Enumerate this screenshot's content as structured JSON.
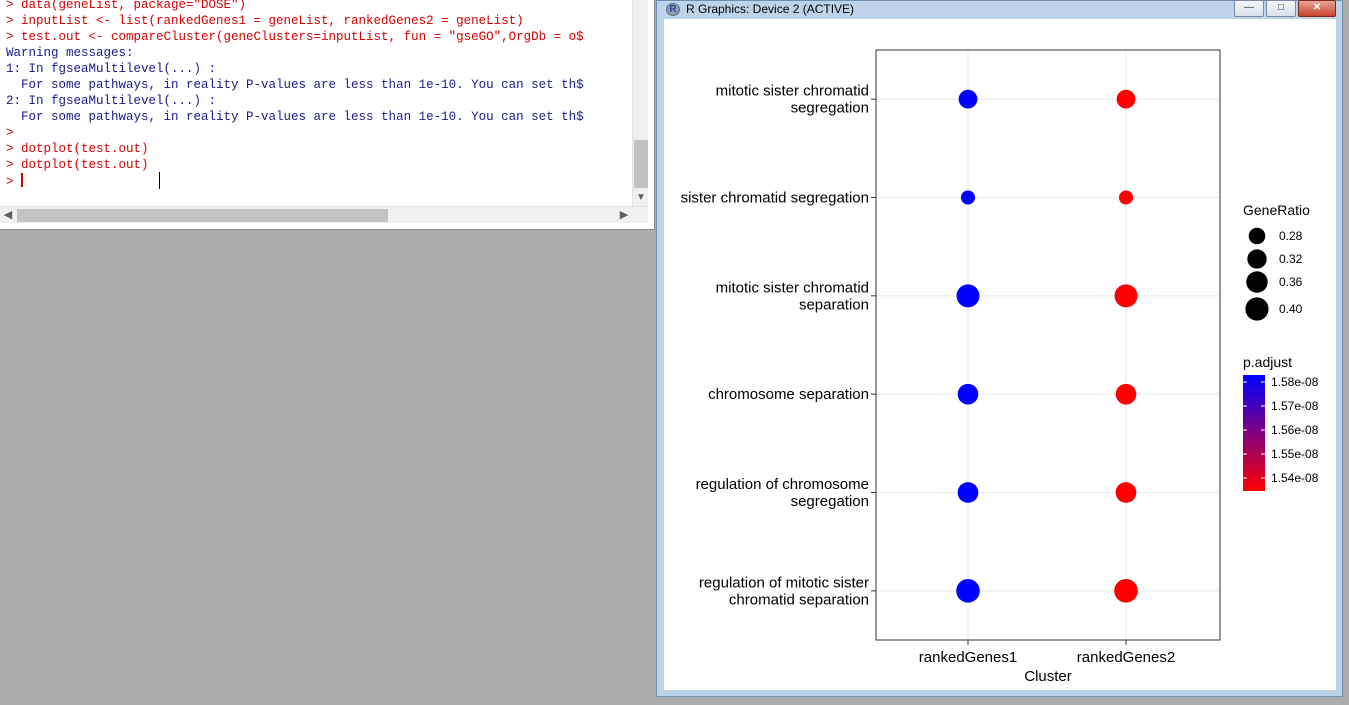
{
  "console": {
    "lines": [
      {
        "type": "cmd",
        "text": "> data(geneList, package=\"DOSE\")"
      },
      {
        "type": "cmd",
        "text": "> inputList <- list(rankedGenes1 = geneList, rankedGenes2 = geneList)"
      },
      {
        "type": "cmd",
        "text": "> test.out <- compareCluster(geneClusters=inputList, fun = \"gseGO\",OrgDb = o$"
      },
      {
        "type": "out",
        "text": "Warning messages:"
      },
      {
        "type": "out",
        "text": "1: In fgseaMultilevel(...) :"
      },
      {
        "type": "out",
        "text": "  For some pathways, in reality P-values are less than 1e-10. You can set th$"
      },
      {
        "type": "out",
        "text": "2: In fgseaMultilevel(...) :"
      },
      {
        "type": "out",
        "text": "  For some pathways, in reality P-values are less than 1e-10. You can set th$"
      },
      {
        "type": "cmd",
        "text": ">"
      },
      {
        "type": "cmd",
        "text": "> dotplot(test.out)"
      },
      {
        "type": "cmd",
        "text": "> dotplot(test.out)"
      }
    ],
    "prompt": "> "
  },
  "graphics_window": {
    "title": "R Graphics: Device 2 (ACTIVE)",
    "icon": "r-logo-icon"
  },
  "chart_data": {
    "type": "scatter",
    "xlabel": "Cluster",
    "ylabel": "",
    "categories": [
      "rankedGenes1",
      "rankedGenes2"
    ],
    "terms": [
      "mitotic sister chromatid segregation",
      "sister chromatid segregation",
      "mitotic sister chromatid separation",
      "chromosome separation",
      "regulation of chromosome segregation",
      "regulation of mitotic sister chromatid separation"
    ],
    "term_labels": [
      [
        "mitotic sister chromatid",
        "segregation"
      ],
      [
        "sister chromatid segregation"
      ],
      [
        "mitotic sister chromatid",
        "separation"
      ],
      [
        "chromosome separation"
      ],
      [
        "regulation of chromosome",
        "segregation"
      ],
      [
        "regulation of mitotic sister",
        "chromatid separation"
      ]
    ],
    "points": [
      {
        "cluster": "rankedGenes1",
        "term": "mitotic sister chromatid segregation",
        "gene_ratio": 0.31,
        "p_adjust": 1.58e-08
      },
      {
        "cluster": "rankedGenes2",
        "term": "mitotic sister chromatid segregation",
        "gene_ratio": 0.31,
        "p_adjust": 1.54e-08
      },
      {
        "cluster": "rankedGenes1",
        "term": "sister chromatid segregation",
        "gene_ratio": 0.255,
        "p_adjust": 1.58e-08
      },
      {
        "cluster": "rankedGenes2",
        "term": "sister chromatid segregation",
        "gene_ratio": 0.255,
        "p_adjust": 1.54e-08
      },
      {
        "cluster": "rankedGenes1",
        "term": "mitotic sister chromatid separation",
        "gene_ratio": 0.395,
        "p_adjust": 1.58e-08
      },
      {
        "cluster": "rankedGenes2",
        "term": "mitotic sister chromatid separation",
        "gene_ratio": 0.395,
        "p_adjust": 1.54e-08
      },
      {
        "cluster": "rankedGenes1",
        "term": "chromosome separation",
        "gene_ratio": 0.345,
        "p_adjust": 1.58e-08
      },
      {
        "cluster": "rankedGenes2",
        "term": "chromosome separation",
        "gene_ratio": 0.345,
        "p_adjust": 1.54e-08
      },
      {
        "cluster": "rankedGenes1",
        "term": "regulation of chromosome segregation",
        "gene_ratio": 0.345,
        "p_adjust": 1.58e-08
      },
      {
        "cluster": "rankedGenes2",
        "term": "regulation of chromosome segregation",
        "gene_ratio": 0.345,
        "p_adjust": 1.54e-08
      },
      {
        "cluster": "rankedGenes1",
        "term": "regulation of mitotic sister chromatid separation",
        "gene_ratio": 0.41,
        "p_adjust": 1.58e-08
      },
      {
        "cluster": "rankedGenes2",
        "term": "regulation of mitotic sister chromatid separation",
        "gene_ratio": 0.41,
        "p_adjust": 1.54e-08
      }
    ],
    "size_legend": {
      "title": "GeneRatio",
      "values": [
        0.28,
        0.32,
        0.36,
        0.4
      ],
      "labels": [
        "0.28",
        "0.32",
        "0.36",
        "0.40"
      ]
    },
    "color_legend": {
      "title": "p.adjust",
      "labels": [
        "1.58e-08",
        "1.57e-08",
        "1.56e-08",
        "1.55e-08",
        "1.54e-08"
      ],
      "high_color": "#0000ff",
      "low_color": "#ff0000"
    },
    "grid": true,
    "legend_position": "right"
  }
}
